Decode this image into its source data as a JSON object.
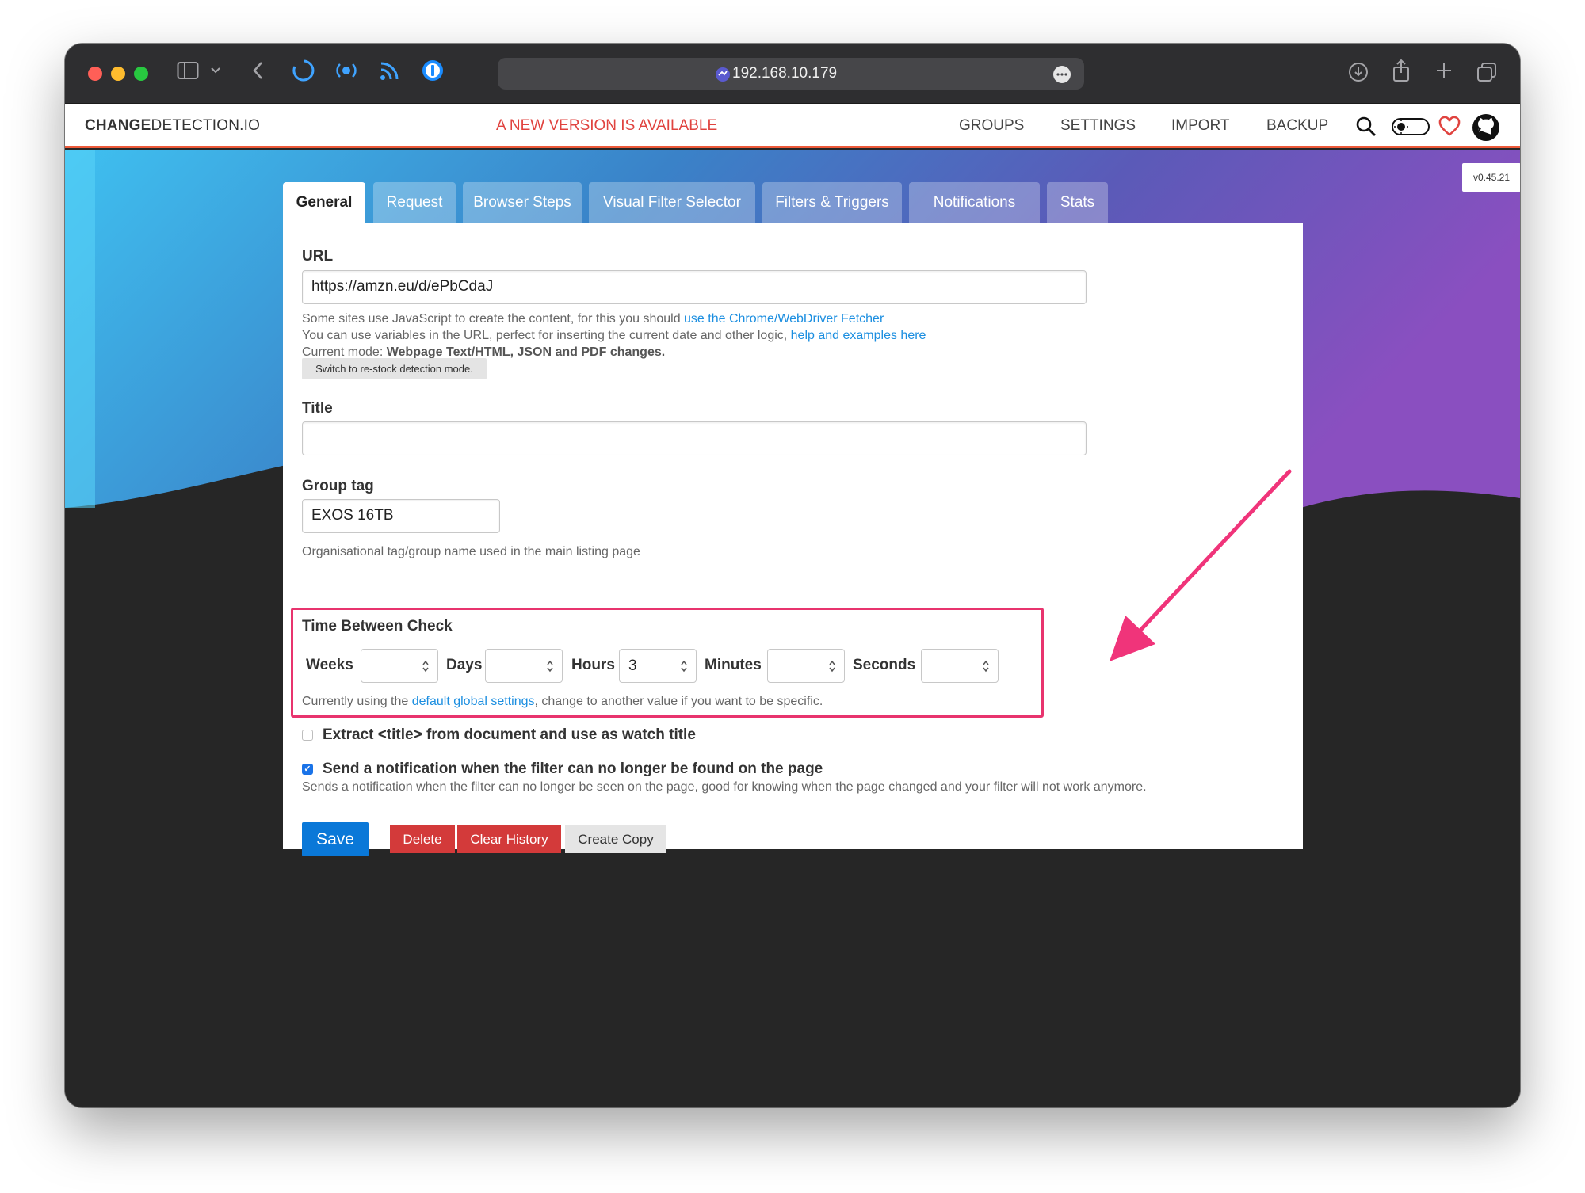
{
  "browser": {
    "url": "192.168.10.179"
  },
  "nav": {
    "logo_bold": "CHANGE",
    "logo_rest": "DETECTION.IO",
    "new_version": "A NEW VERSION IS AVAILABLE",
    "links": [
      "GROUPS",
      "SETTINGS",
      "IMPORT",
      "BACKUP"
    ]
  },
  "version": "v0.45.21",
  "tabs": [
    {
      "label": "General",
      "active": true
    },
    {
      "label": "Request"
    },
    {
      "label": "Browser Steps"
    },
    {
      "label": "Visual Filter Selector"
    },
    {
      "label": "Filters & Triggers"
    },
    {
      "label": "Notifications"
    },
    {
      "label": "Stats"
    }
  ],
  "form": {
    "url_label": "URL",
    "url_value": "https://amzn.eu/d/ePbCdaJ",
    "help1_text": "Some sites use JavaScript to create the content, for this you should ",
    "help1_link": "use the Chrome/WebDriver Fetcher",
    "help2_text": "You can use variables in the URL, perfect for inserting the current date and other logic, ",
    "help2_link": "help and examples here",
    "mode_prefix": "Current mode: ",
    "mode_value": "Webpage Text/HTML, JSON and PDF changes.",
    "restock_button": "Switch to re-stock detection mode.",
    "title_label": "Title",
    "title_value": "",
    "group_label": "Group tag",
    "group_value": "EXOS 16TB",
    "group_help": "Organisational tag/group name used in the main listing page",
    "time_label": "Time Between Check",
    "time_fields": {
      "weeks_label": "Weeks",
      "weeks_value": "",
      "days_label": "Days",
      "days_value": "",
      "hours_label": "Hours",
      "hours_value": "3",
      "minutes_label": "Minutes",
      "minutes_value": "",
      "seconds_label": "Seconds",
      "seconds_value": ""
    },
    "time_help_prefix": "Currently using the ",
    "time_help_link": "default global settings",
    "time_help_suffix": ", change to another value if you want to be specific.",
    "extract_title_label": "Extract <title> from document and use as watch title",
    "extract_title_checked": false,
    "notify_label": "Send a notification when the filter can no longer be found on the page",
    "notify_checked": true,
    "notify_help": "Sends a notification when the filter can no longer be seen on the page, good for knowing when the page changed and your filter will not work anymore."
  },
  "buttons": {
    "save": "Save",
    "delete": "Delete",
    "clear_history": "Clear History",
    "create_copy": "Create Copy"
  },
  "colors": {
    "accent_blue": "#0a78d8",
    "danger_red": "#d33a3a",
    "highlight_pink": "#e8346e",
    "nav_underline": "#ed5a3a"
  }
}
